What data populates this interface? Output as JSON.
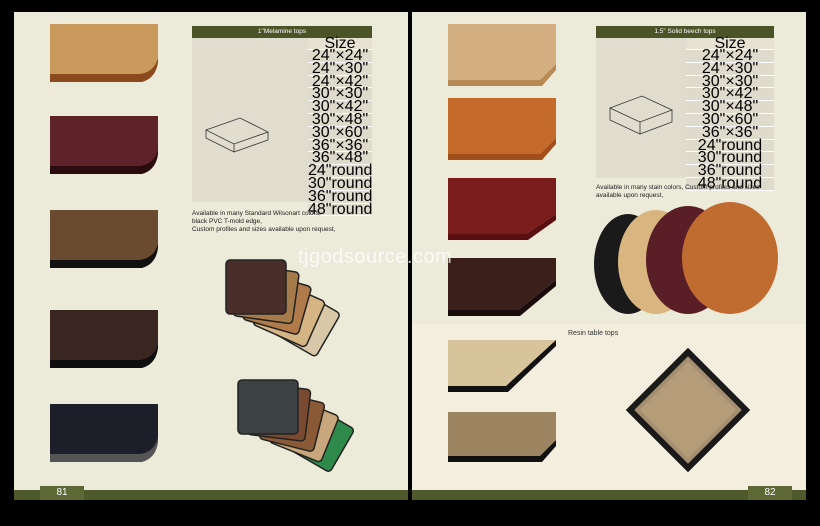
{
  "left_page": {
    "page_number": "81",
    "table": {
      "title": "1\"Melamine tops",
      "header": "Size",
      "sizes": [
        "24\"×24\"",
        "24\"×30\"",
        "24\"×42\"",
        "30\"×30\"",
        "30\"×42\"",
        "30\"×48\"",
        "30\"×60\"",
        "36\"×36\"",
        "36\"×48\"",
        "24\"round",
        "30\"round",
        "36\"round",
        "48\"round"
      ]
    },
    "caption": [
      "Available in many Standard Wilsonart colors,",
      "black PVC T-mold edge,",
      "Custom profiles and sizes available upon request,"
    ],
    "swatch_colors": [
      "#c99a5c",
      "#5e2328",
      "#6a4b30",
      "#3a2620",
      "#1e1e2a"
    ]
  },
  "right_page": {
    "page_number": "82",
    "table": {
      "title": "1.5\" Solid beech tops",
      "header": "Size",
      "sizes": [
        "24\"×24\"",
        "24\"×30\"",
        "30\"×30\"",
        "30\"×42\"",
        "30\"×48\"",
        "30\"×60\"",
        "36\"×36\"",
        "24\"round",
        "30\"round",
        "36\"round",
        "48\"round"
      ]
    },
    "caption": [
      "Available in many stain colors, Custom profiles and sizes",
      "available upon request,"
    ],
    "resin_title": "Resin table tops",
    "swatch_colors": [
      "#d2ae80",
      "#c46a2a",
      "#7b1c1c",
      "#3a1f1a"
    ]
  },
  "watermark": "tjgodsource.com"
}
